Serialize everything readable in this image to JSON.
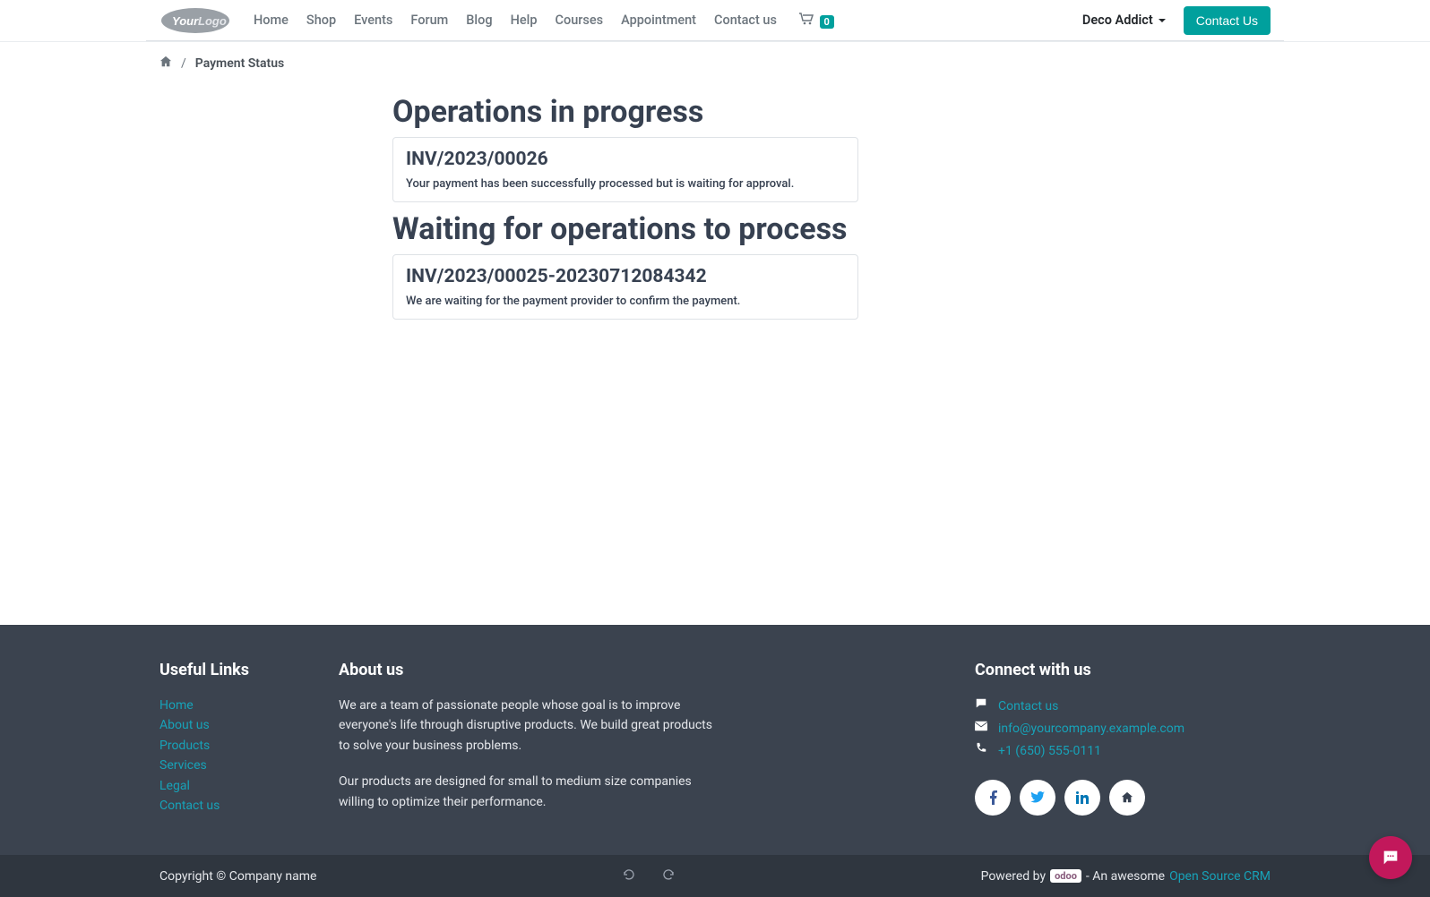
{
  "nav": {
    "items": [
      "Home",
      "Shop",
      "Events",
      "Forum",
      "Blog",
      "Help",
      "Courses",
      "Appointment",
      "Contact us"
    ],
    "cart_count": "0",
    "user": "Deco Addict",
    "contact_button": "Contact Us"
  },
  "breadcrumb": {
    "current": "Payment Status"
  },
  "main": {
    "sections": [
      {
        "title": "Operations in progress",
        "card_title": "INV/2023/00026",
        "card_text": "Your payment has been successfully processed but is waiting for approval."
      },
      {
        "title": "Waiting for operations to process",
        "card_title": "INV/2023/00025-20230712084342",
        "card_text": "We are waiting for the payment provider to confirm the payment."
      }
    ]
  },
  "footer": {
    "useful_heading": "Useful Links",
    "useful_links": [
      "Home",
      "About us",
      "Products",
      "Services",
      "Legal",
      "Contact us"
    ],
    "about_heading": "About us",
    "about_p1": "We are a team of passionate people whose goal is to improve everyone's life through disruptive products. We build great products to solve your business problems.",
    "about_p2": "Our products are designed for small to medium size companies willing to optimize their performance.",
    "connect_heading": "Connect with us",
    "contact_us_link": "Contact us",
    "email": "info@yourcompany.example.com",
    "phone": "+1 (650) 555-0111"
  },
  "bottom": {
    "copyright": "Copyright © Company name",
    "powered_prefix": "Powered by",
    "odoo": "odoo",
    "powered_mid": "- An awesome",
    "crm_link": "Open Source CRM"
  }
}
